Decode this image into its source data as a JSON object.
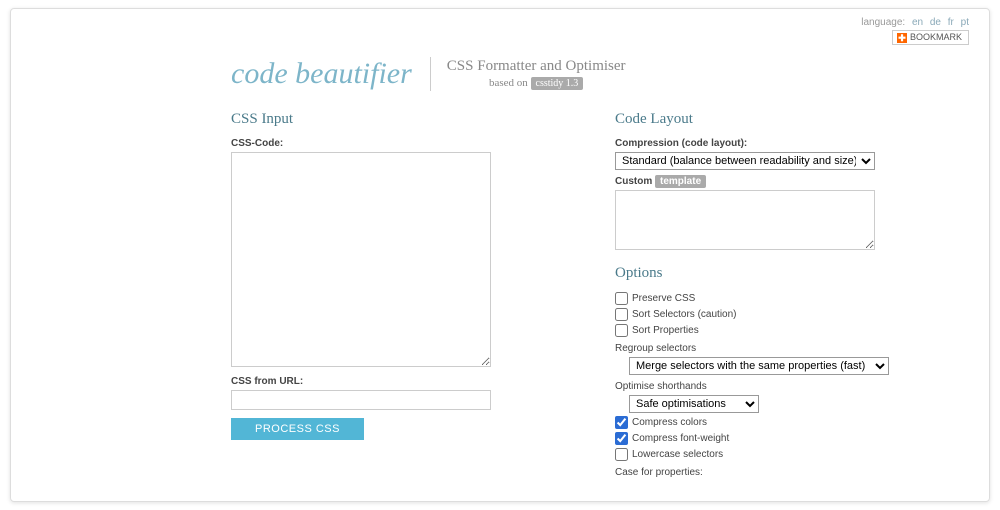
{
  "topbar": {
    "language_label": "language:",
    "langs": [
      "en",
      "de",
      "fr",
      "pt"
    ],
    "bookmark": "BOOKMARK"
  },
  "header": {
    "logo": "code beautifier",
    "tagline": "CSS Formatter and Optimiser",
    "based_on": "based on",
    "csstidy": "csstidy 1.3"
  },
  "left": {
    "title": "CSS Input",
    "code_label": "CSS-Code:",
    "url_label": "CSS from URL:",
    "process_btn": "PROCESS CSS"
  },
  "right": {
    "layout_title": "Code Layout",
    "compression_label": "Compression (code layout):",
    "compression_value": "Standard (balance between readability and size)",
    "custom_label": "Custom",
    "template_pill": "template",
    "options_title": "Options",
    "chk_preserve": "Preserve CSS",
    "chk_sort_sel": "Sort Selectors (caution)",
    "chk_sort_prop": "Sort Properties",
    "regroup_label": "Regroup selectors",
    "regroup_value": "Merge selectors with the same properties (fast)",
    "optimise_label": "Optimise shorthands",
    "optimise_value": "Safe optimisations",
    "chk_colors": "Compress colors",
    "chk_fontweight": "Compress font-weight",
    "chk_lowercase": "Lowercase selectors",
    "case_label": "Case for properties:"
  }
}
